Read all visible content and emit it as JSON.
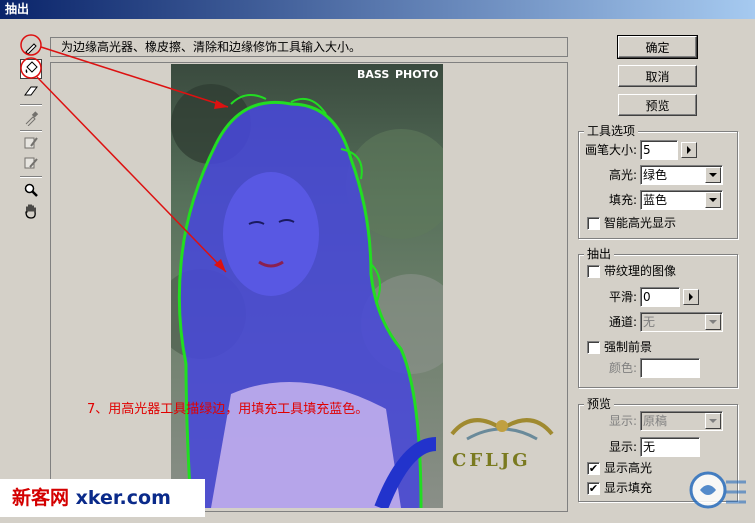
{
  "window": {
    "title": "抽出"
  },
  "hint": "为边缘高光器、橡皮擦、清除和边缘修饰工具输入大小。",
  "toolbar": {
    "tools": [
      {
        "icon": "edge-highlighter-icon",
        "active": false,
        "disabled": false
      },
      {
        "icon": "fill-bucket-icon",
        "active": true,
        "disabled": false
      },
      {
        "icon": "eraser-icon",
        "active": false,
        "disabled": false
      },
      {
        "icon": "eyedropper-icon",
        "active": false,
        "disabled": true
      },
      {
        "icon": "cleanup-icon",
        "active": false,
        "disabled": true
      },
      {
        "icon": "edge-touchup-icon",
        "active": false,
        "disabled": true
      },
      {
        "icon": "zoom-icon",
        "active": false,
        "disabled": false
      },
      {
        "icon": "hand-icon",
        "active": false,
        "disabled": false
      }
    ]
  },
  "buttons": {
    "ok": "确定",
    "cancel": "取消",
    "preview": "预览"
  },
  "tool_options": {
    "title": "工具选项",
    "brush_size_label": "画笔大小:",
    "brush_size_value": "5",
    "highlight_label": "高光:",
    "highlight_value": "绿色",
    "fill_label": "填充:",
    "fill_value": "蓝色",
    "smart_highlight_label": "智能高光显示",
    "smart_highlight_checked": false
  },
  "extraction": {
    "title": "抽出",
    "textured_label": "带纹理的图像",
    "textured_checked": false,
    "smooth_label": "平滑:",
    "smooth_value": "0",
    "channel_label": "通道:",
    "channel_value": "无",
    "force_fg_label": "强制前景",
    "force_fg_checked": false,
    "color_label": "颜色:"
  },
  "preview": {
    "title": "预览",
    "show_label": "显示:",
    "show_value": "原稿",
    "display_label": "显示:",
    "display_value": "无",
    "show_highlight_label": "显示高光",
    "show_highlight_checked": true,
    "show_fill_label": "显示填充",
    "show_fill_checked": true
  },
  "photo": {
    "corner_text_1": "BASS",
    "corner_text_2": "PHOTO",
    "logo_text": "CFLJG"
  },
  "annotation": "7、用高光器工具描绿边，用填充工具填充蓝色。",
  "watermark": {
    "part1": "新客网",
    "part2": " xker.com"
  },
  "colors": {
    "highlight": "#22dd22",
    "fill": "#3333ee",
    "annotation": "#e00000",
    "arrow": "#dd1111"
  }
}
